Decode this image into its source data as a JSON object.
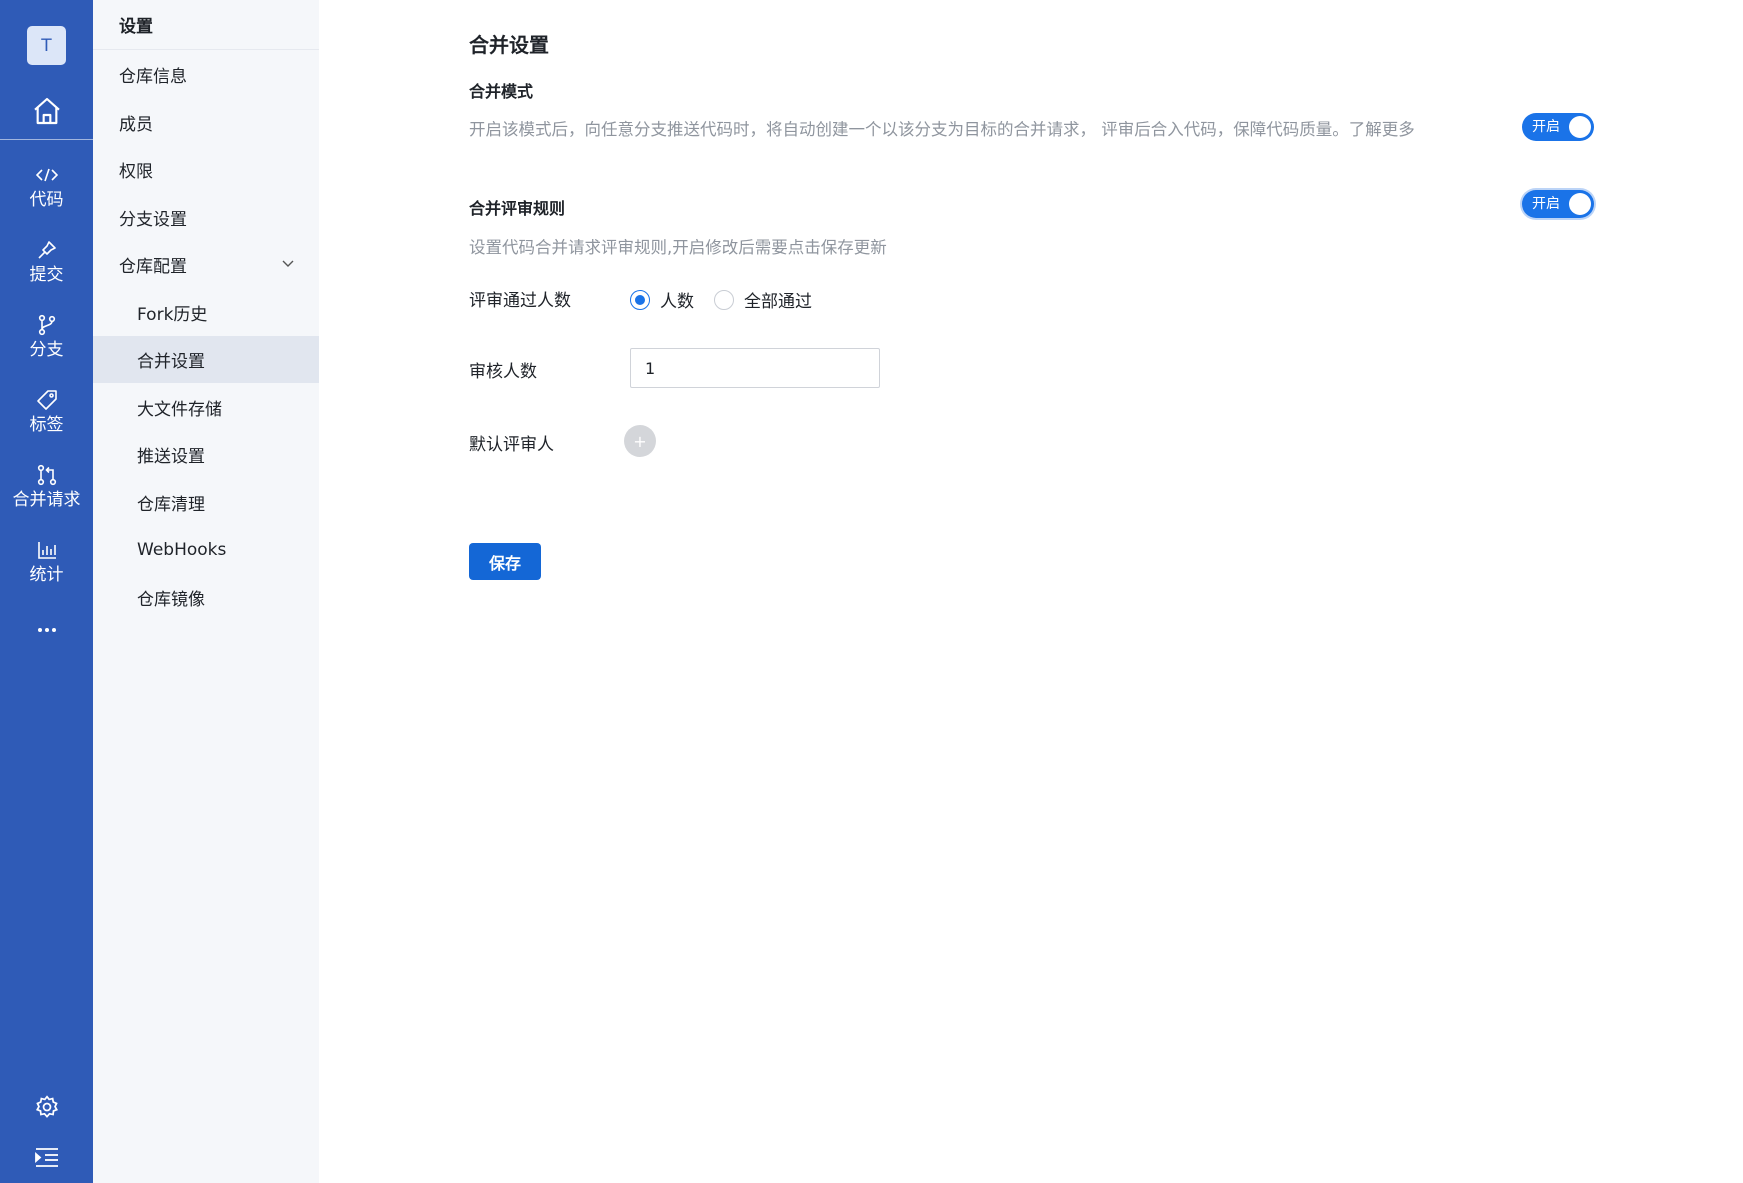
{
  "rail": {
    "avatar_letter": "T",
    "items": [
      {
        "icon": "code-icon",
        "label": "代码"
      },
      {
        "icon": "pin-icon",
        "label": "提交"
      },
      {
        "icon": "branch-icon",
        "label": "分支"
      },
      {
        "icon": "tag-icon",
        "label": "标签"
      },
      {
        "icon": "merge-request-icon",
        "label": "合并请求"
      },
      {
        "icon": "chart-icon",
        "label": "统计"
      }
    ],
    "bottom_icons": [
      "gear-icon",
      "collapse-menu-icon"
    ]
  },
  "subnav": {
    "title": "设置",
    "items": [
      {
        "label": "仓库信息"
      },
      {
        "label": "成员"
      },
      {
        "label": "权限"
      },
      {
        "label": "分支设置"
      },
      {
        "label": "仓库配置"
      }
    ],
    "sub_items": [
      {
        "label": "Fork历史"
      },
      {
        "label": "合并设置"
      },
      {
        "label": "大文件存储"
      },
      {
        "label": "推送设置"
      },
      {
        "label": "仓库清理"
      },
      {
        "label": "WebHooks"
      },
      {
        "label": "仓库镜像"
      }
    ]
  },
  "main": {
    "title": "合并设置",
    "merge_mode": {
      "title": "合并模式",
      "description": "开启该模式后，向任意分支推送代码时，将自动创建一个以该分支为目标的合并请求， 评审后合入代码，保障代码质量。了解更多",
      "toggle_label": "开启"
    },
    "review_rules": {
      "title": "合并评审规则",
      "description": "设置代码合并请求评审规则,开启修改后需要点击保存更新",
      "toggle_label": "开启"
    },
    "form": {
      "pass_label": "评审通过人数",
      "radio_count": "人数",
      "radio_all": "全部通过",
      "reviewer_count_label": "审核人数",
      "reviewer_count_value": "1",
      "default_reviewer_label": "默认评审人",
      "add_symbol": "+"
    },
    "save_label": "保存"
  },
  "colors": {
    "rail_bg": "#2f5bb7",
    "subnav_bg": "#f5f7fa",
    "accent": "#1a73e8",
    "save_btn": "#1467d6"
  }
}
